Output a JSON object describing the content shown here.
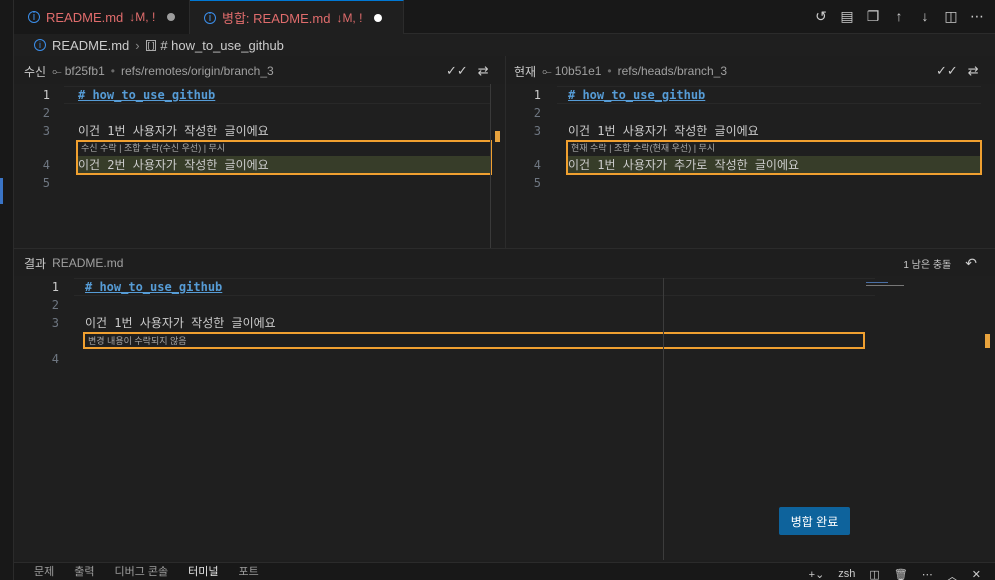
{
  "tabs": [
    {
      "title": "README.md",
      "status": "↓M, !"
    },
    {
      "title": "병합: README.md",
      "status": "↓M, !"
    }
  ],
  "breadcrumb": {
    "file": "README.md",
    "symbol": "# how_to_use_github"
  },
  "incoming": {
    "label": "수신",
    "hash": "bf25fb1",
    "ref": "refs/remotes/origin/branch_3",
    "lines": [
      {
        "n": "1",
        "text": "# how_to_use_github"
      },
      {
        "n": "2",
        "text": ""
      },
      {
        "n": "3",
        "text": "이건 1번 사용자가 작성한 글이에요"
      },
      {
        "n": "4",
        "text": "이건 2번 사용자가 작성한 글이에요"
      },
      {
        "n": "5",
        "text": ""
      }
    ],
    "codelens": "수신 수락 | 조합 수락(수신 우선) | 무시"
  },
  "current": {
    "label": "현재",
    "hash": "10b51e1",
    "ref": "refs/heads/branch_3",
    "lines": [
      {
        "n": "1",
        "text": "# how_to_use_github"
      },
      {
        "n": "2",
        "text": ""
      },
      {
        "n": "3",
        "text": "이건 1번 사용자가 작성한 글이에요"
      },
      {
        "n": "4",
        "text": "이건 1번 사용자가 추가로 작성한 글이에요"
      },
      {
        "n": "5",
        "text": ""
      }
    ],
    "codelens": "현재 수락 | 조합 수락(현재 우선) | 무시"
  },
  "result": {
    "label": "결과",
    "file": "README.md",
    "conflicts_left": "1 남은 충돌",
    "lines": [
      {
        "n": "1",
        "text": "# how_to_use_github"
      },
      {
        "n": "2",
        "text": ""
      },
      {
        "n": "3",
        "text": "이건 1번 사용자가 작성한 글이에요"
      },
      {
        "n": "4",
        "text": ""
      }
    ],
    "codelens": "변경 내용이 수락되지 않음"
  },
  "complete_merge_label": "병합 완료",
  "panel_tabs": [
    "문제",
    "출력",
    "디버그 콘솔",
    "터미널",
    "포트"
  ],
  "terminal_shell": "zsh",
  "colors": {
    "accent": "#0e639c",
    "conflict_border": "#f0a030",
    "highlight_line": "#373d29",
    "heading": "#569cd6",
    "modified_tab": "#e06c6c"
  }
}
